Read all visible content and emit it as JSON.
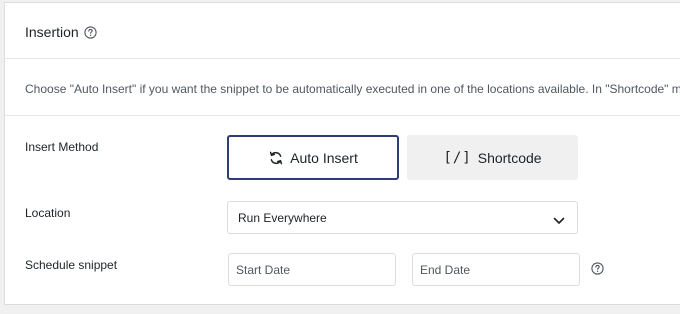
{
  "section": {
    "title": "Insertion",
    "description": "Choose \"Auto Insert\" if you want the snippet to be automatically executed in one of the locations available. In \"Shortcode\" mode, the snippet will only be executed where the shortcode is inserted."
  },
  "insert_method": {
    "label": "Insert Method",
    "options": [
      {
        "label": "Auto Insert",
        "icon": "refresh-icon",
        "selected": true
      },
      {
        "label": "Shortcode",
        "icon": "brackets-icon",
        "selected": false
      }
    ],
    "shortcode_icon_text": "[/]"
  },
  "location": {
    "label": "Location",
    "selected": "Run Everywhere"
  },
  "schedule": {
    "label": "Schedule snippet",
    "start_placeholder": "Start Date",
    "end_placeholder": "End Date"
  },
  "colors": {
    "active_border": "#2c3e74",
    "inactive_bg": "#f0f0f1",
    "border": "#dcdcde",
    "text": "#1d2327"
  }
}
